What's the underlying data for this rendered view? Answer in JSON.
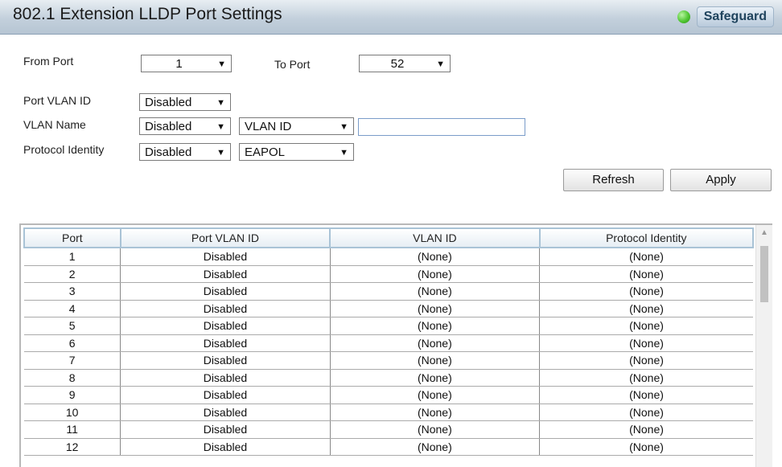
{
  "header": {
    "title": "802.1 Extension LLDP Port Settings",
    "badge": "Safeguard"
  },
  "form": {
    "from_port_label": "From Port",
    "from_port_value": "1",
    "to_port_label": "To Port",
    "to_port_value": "52",
    "port_vlan_label": "Port VLAN ID",
    "port_vlan_value": "Disabled",
    "vlan_name_label": "VLAN Name",
    "vlan_name_value": "Disabled",
    "vlan_name_type": "VLAN ID",
    "vlan_name_input": "",
    "protocol_label": "Protocol Identity",
    "protocol_value": "Disabled",
    "protocol_type": "EAPOL",
    "refresh_label": "Refresh",
    "apply_label": "Apply"
  },
  "table": {
    "columns": [
      "Port",
      "Port VLAN ID",
      "VLAN ID",
      "Protocol Identity"
    ],
    "rows": [
      [
        "1",
        "Disabled",
        "(None)",
        "(None)"
      ],
      [
        "2",
        "Disabled",
        "(None)",
        "(None)"
      ],
      [
        "3",
        "Disabled",
        "(None)",
        "(None)"
      ],
      [
        "4",
        "Disabled",
        "(None)",
        "(None)"
      ],
      [
        "5",
        "Disabled",
        "(None)",
        "(None)"
      ],
      [
        "6",
        "Disabled",
        "(None)",
        "(None)"
      ],
      [
        "7",
        "Disabled",
        "(None)",
        "(None)"
      ],
      [
        "8",
        "Disabled",
        "(None)",
        "(None)"
      ],
      [
        "9",
        "Disabled",
        "(None)",
        "(None)"
      ],
      [
        "10",
        "Disabled",
        "(None)",
        "(None)"
      ],
      [
        "11",
        "Disabled",
        "(None)",
        "(None)"
      ],
      [
        "12",
        "Disabled",
        "(None)",
        "(None)"
      ]
    ]
  },
  "icons": {
    "status": "green-dot-icon",
    "dropdown": "chevron-down-icon",
    "scroll_up": "scroll-up-arrow-icon"
  }
}
